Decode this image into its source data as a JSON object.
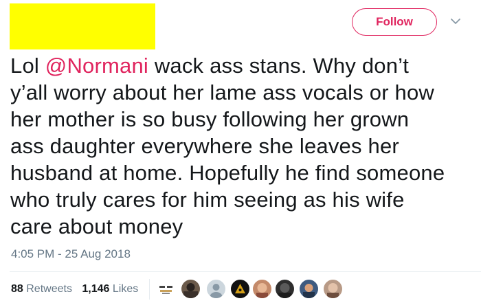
{
  "header": {
    "follow_label": "Follow",
    "menu_icon": "chevron-down-icon",
    "accent_color": "#e0245e"
  },
  "tweet": {
    "lines": [
      {
        "before": "Lol ",
        "mention": "@Normani",
        "after": " wack ass stans. Why don’t"
      },
      {
        "text": "y’all worry about her lame ass vocals or how"
      },
      {
        "text": "her mother is so busy following her grown"
      },
      {
        "text": "ass daughter everywhere she leaves her"
      },
      {
        "text": "husband at home. Hopefully he find someone"
      },
      {
        "text": "who truly cares for him seeing as his wife"
      },
      {
        "text": "care about money"
      }
    ],
    "timestamp": "4:05 PM - 25 Aug 2018"
  },
  "stats": {
    "retweets_count": "88",
    "retweets_label": "Retweets",
    "likes_count": "1,146",
    "likes_label": "Likes"
  },
  "likers": [
    {
      "icon": "avatar-image"
    },
    {
      "icon": "avatar-image"
    },
    {
      "icon": "default-avatar-icon"
    },
    {
      "icon": "avatar-image"
    },
    {
      "icon": "avatar-image"
    },
    {
      "icon": "avatar-image"
    },
    {
      "icon": "avatar-image"
    },
    {
      "icon": "avatar-image"
    }
  ]
}
